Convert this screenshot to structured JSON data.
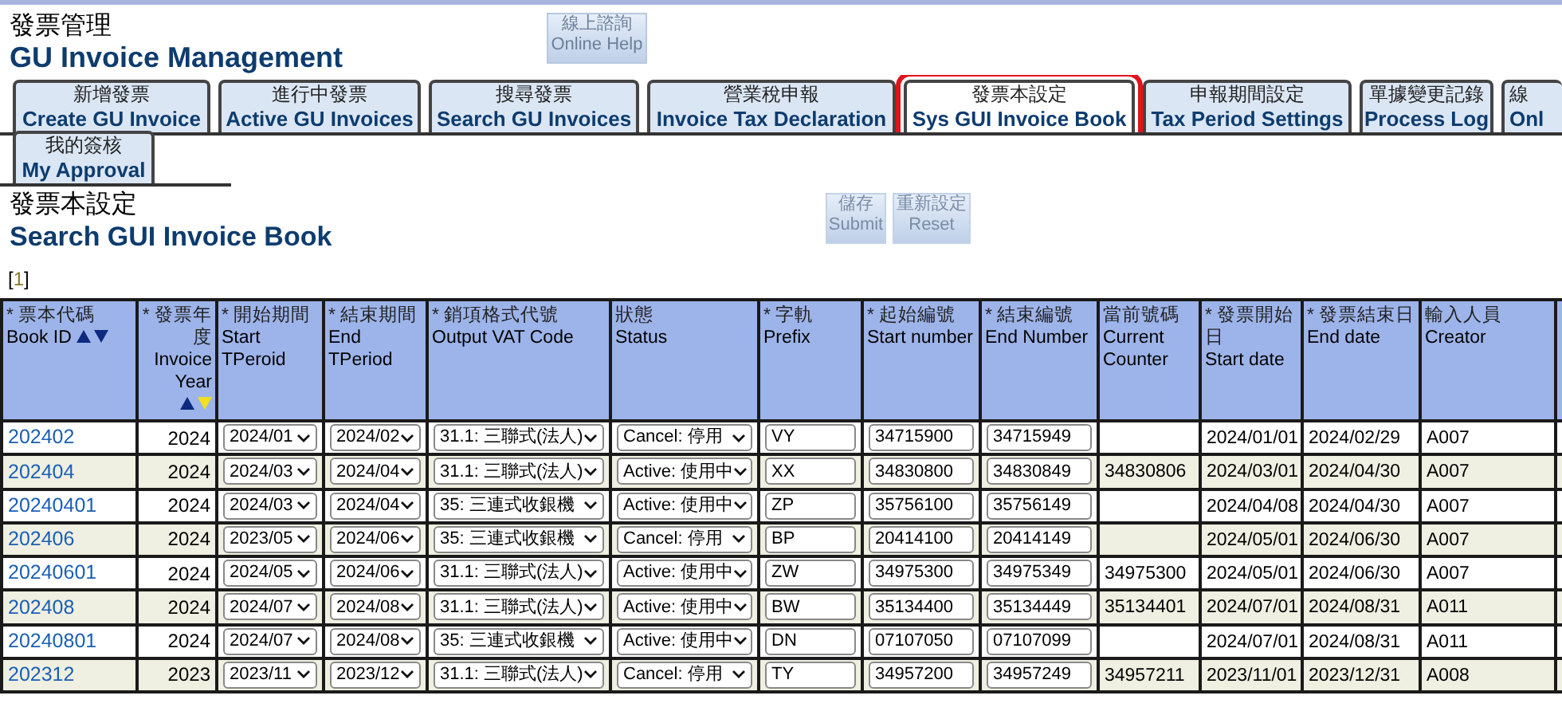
{
  "header": {
    "title_zh": "發票管理",
    "title_en": "GU Invoice Management",
    "help_button": {
      "zh": "線上諮詢",
      "en": "Online Help"
    }
  },
  "tabs": [
    {
      "zh": "新增發票",
      "en": "Create GU Invoice",
      "selected": false
    },
    {
      "zh": "進行中發票",
      "en": "Active GU Invoices",
      "selected": false
    },
    {
      "zh": "搜尋發票",
      "en": "Search GU Invoices",
      "selected": false
    },
    {
      "zh": "營業稅申報",
      "en": "Invoice Tax Declaration",
      "selected": false
    },
    {
      "zh": "發票本設定",
      "en": "Sys GUI Invoice Book",
      "selected": true
    },
    {
      "zh": "申報期間設定",
      "en": "Tax Period Settings",
      "selected": false
    },
    {
      "zh": "單據變更記錄",
      "en": "Process Log",
      "selected": false
    },
    {
      "zh": "線",
      "en": "Onl",
      "selected": false
    },
    {
      "zh": "我的簽核",
      "en": "My Approval",
      "selected": false
    }
  ],
  "section": {
    "title_zh": "發票本設定",
    "title_en": "Search GUI Invoice Book",
    "buttons": [
      {
        "zh": "儲存",
        "en": "Submit"
      },
      {
        "zh": "重新設定",
        "en": "Reset"
      }
    ],
    "pager": {
      "open": "[",
      "page": "1",
      "close": "]"
    }
  },
  "table": {
    "columns": [
      {
        "zh": "* 票本代碼",
        "en": "Book ID",
        "kind": "link",
        "sort_arrows": true
      },
      {
        "zh": "* 發票年度",
        "en": "Invoice Year",
        "kind": "number",
        "sort_arrows": true,
        "sorted_descending": true
      },
      {
        "zh": "* 開始期間",
        "en": "Start TPeroid",
        "kind": "select"
      },
      {
        "zh": "* 結束期間",
        "en": "End TPeriod",
        "kind": "select"
      },
      {
        "zh": "* 銷項格式代號",
        "en": "Output VAT Code",
        "kind": "select"
      },
      {
        "zh": "狀態",
        "en": "Status",
        "kind": "select"
      },
      {
        "zh": "* 字軌",
        "en": "Prefix",
        "kind": "input"
      },
      {
        "zh": "* 起始編號",
        "en": "Start number",
        "kind": "input"
      },
      {
        "zh": "* 結束編號",
        "en": "End Number",
        "kind": "input"
      },
      {
        "zh": "當前號碼",
        "en": "Current Counter",
        "kind": "text"
      },
      {
        "zh": "* 發票開始日",
        "en": "Start date",
        "kind": "text"
      },
      {
        "zh": "* 發票結束日",
        "en": "End date",
        "kind": "text"
      },
      {
        "zh": "輸入人員",
        "en": "Creator",
        "kind": "text"
      }
    ],
    "rows": [
      [
        "202402",
        "2024",
        "2024/01",
        "2024/02",
        "31.1: 三聯式(法人)",
        "Cancel: 停用",
        "VY",
        "34715900",
        "34715949",
        null,
        "2024/01/01",
        "2024/02/29",
        "A007"
      ],
      [
        "202404",
        "2024",
        "2024/03",
        "2024/04",
        "31.1: 三聯式(法人)",
        "Active: 使用中",
        "XX",
        "34830800",
        "34830849",
        "34830806",
        "2024/03/01",
        "2024/04/30",
        "A007"
      ],
      [
        "20240401",
        "2024",
        "2024/03",
        "2024/04",
        "35: 三連式收銀機",
        "Active: 使用中",
        "ZP",
        "35756100",
        "35756149",
        null,
        "2024/04/08",
        "2024/04/30",
        "A007"
      ],
      [
        "202406",
        "2024",
        "2023/05",
        "2024/06",
        "35: 三連式收銀機",
        "Cancel: 停用",
        "BP",
        "20414100",
        "20414149",
        null,
        "2024/05/01",
        "2024/06/30",
        "A007"
      ],
      [
        "20240601",
        "2024",
        "2024/05",
        "2024/06",
        "31.1: 三聯式(法人)",
        "Active: 使用中",
        "ZW",
        "34975300",
        "34975349",
        "34975300",
        "2024/05/01",
        "2024/06/30",
        "A007"
      ],
      [
        "202408",
        "2024",
        "2024/07",
        "2024/08",
        "31.1: 三聯式(法人)",
        "Active: 使用中",
        "BW",
        "35134400",
        "35134449",
        "35134401",
        "2024/07/01",
        "2024/08/31",
        "A011"
      ],
      [
        "20240801",
        "2024",
        "2024/07",
        "2024/08",
        "35: 三連式收銀機",
        "Active: 使用中",
        "DN",
        "07107050",
        "07107099",
        null,
        "2024/07/01",
        "2024/08/31",
        "A011"
      ],
      [
        "202312",
        "2023",
        "2023/11",
        "2023/12",
        "31.1: 三聯式(法人)",
        "Cancel: 停用",
        "TY",
        "34957200",
        "34957249",
        "34957211",
        "2023/11/01",
        "2023/12/31",
        "A008"
      ]
    ]
  }
}
